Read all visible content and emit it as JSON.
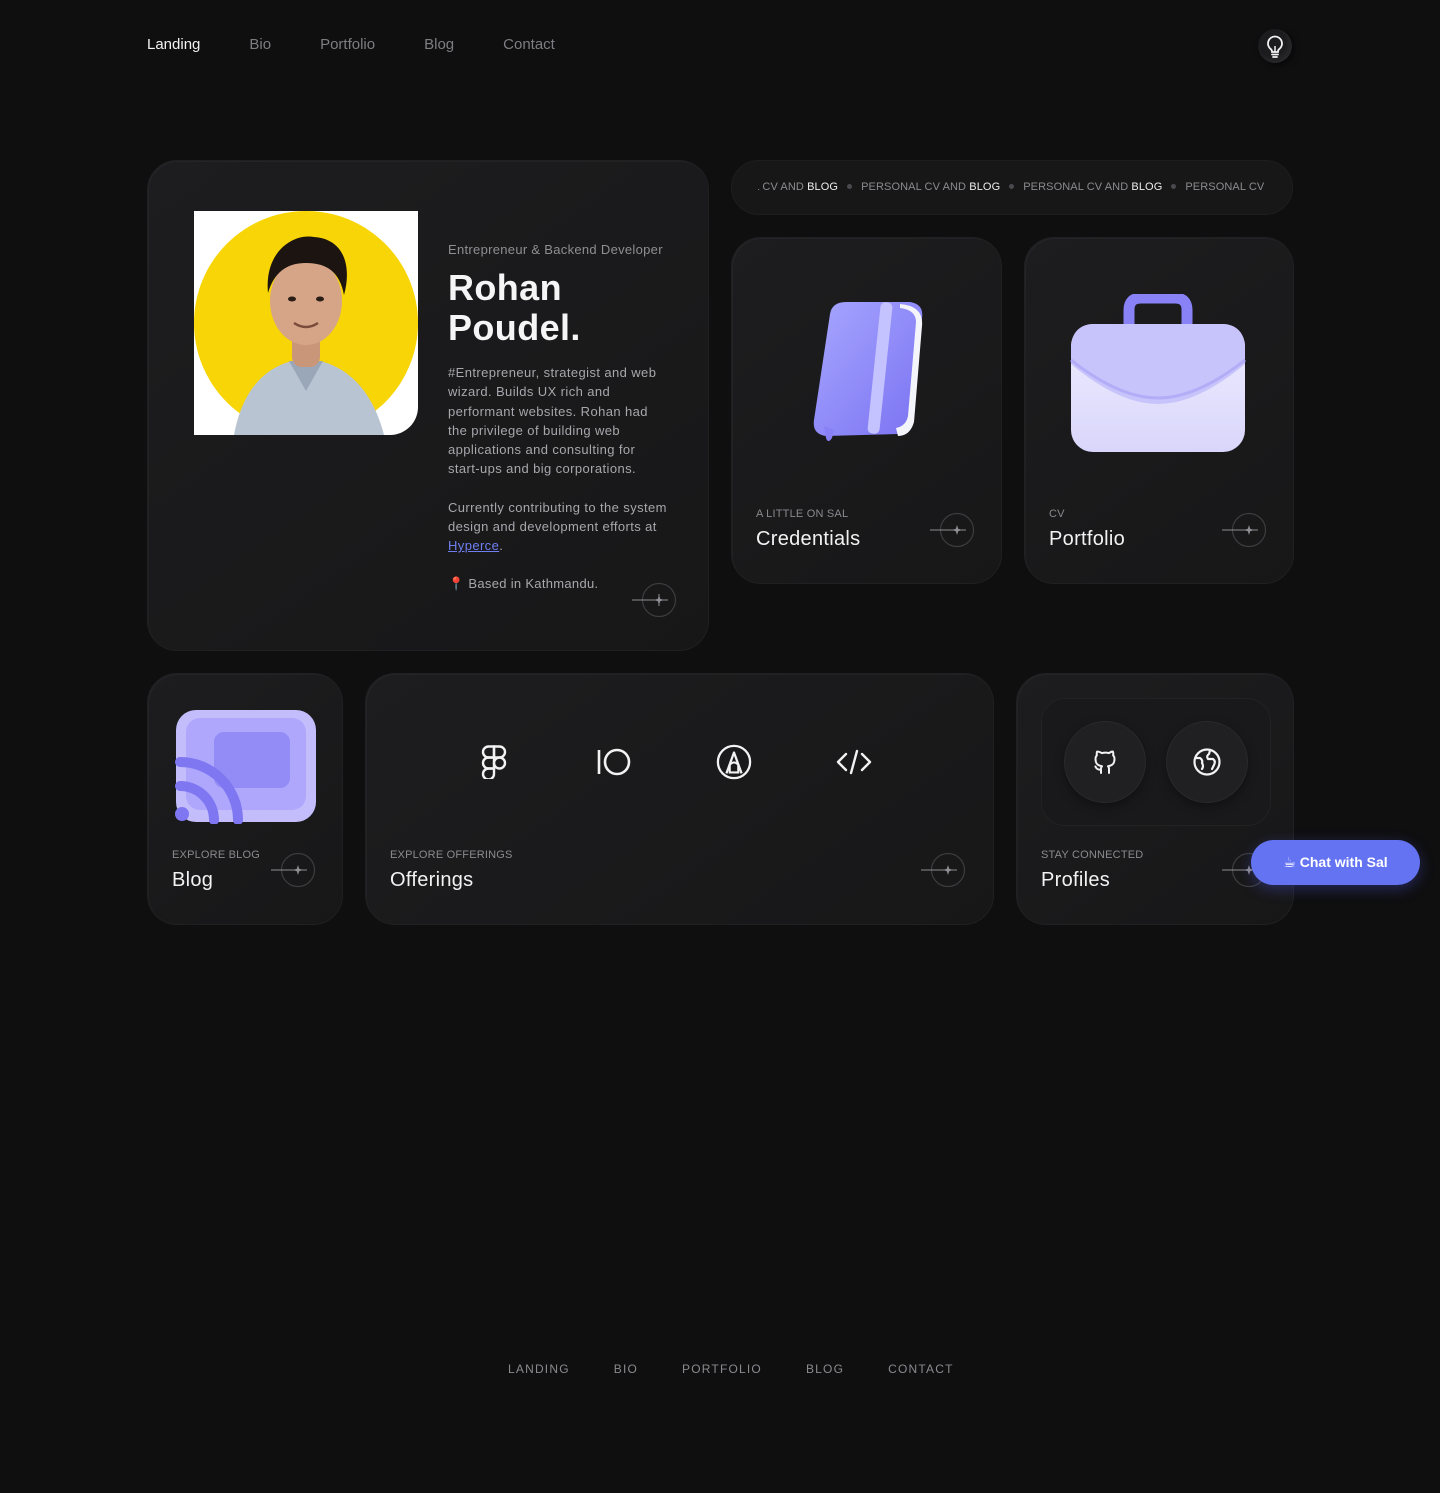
{
  "nav": {
    "items": [
      "Landing",
      "Bio",
      "Portfolio",
      "Blog",
      "Contact"
    ],
    "active": "Landing",
    "theme_toggle_icon": "lightbulb-icon"
  },
  "intro": {
    "role": "Entrepreneur & Backend Developer",
    "name_line1": "Rohan",
    "name_line2": "Poudel.",
    "bio_p1": "#Entrepreneur, strategist and web wizard. Builds UX rich and performant websites. Rohan had the privilege of building web applications and consulting for start-ups and big corporations.",
    "bio_p2_prefix": "Currently contributing to the system design and development efforts at ",
    "bio_p2_link": "Hyperce",
    "bio_p2_suffix": ".",
    "location_icon": "pin-icon",
    "location": "Based in Kathmandu."
  },
  "marquee": {
    "prefix": "AL CV AND ",
    "strong": "BLOG",
    "repeat_prefix": "PERSONAL CV AND ",
    "tail": "PERSONAL CV"
  },
  "cards": {
    "credentials": {
      "eyebrow": "A LITTLE ON SAL",
      "title": "Credentials",
      "icon": "book-icon"
    },
    "portfolio": {
      "eyebrow": "CV",
      "title": "Portfolio",
      "icon": "briefcase-icon"
    },
    "blog": {
      "eyebrow": "EXPLORE BLOG",
      "title": "Blog",
      "icon": "rss-cast-icon"
    },
    "offerings": {
      "eyebrow": "EXPLORE OFFERINGS",
      "title": "Offerings",
      "icons": [
        "figma-icon",
        "framer-io-icon",
        "pen-tool-icon",
        "code-icon"
      ]
    },
    "profiles": {
      "eyebrow": "STAY CONNECTED",
      "title": "Profiles",
      "icons": [
        "github-icon",
        "globe-icon"
      ]
    }
  },
  "chat": {
    "label": "☕ Chat with Sal"
  },
  "footer": {
    "items": [
      "LANDING",
      "BIO",
      "PORTFOLIO",
      "BLOG",
      "CONTACT"
    ]
  },
  "colors": {
    "background": "#0f0f10",
    "accent": "#6373f2",
    "link": "#6f7ff1",
    "avatar_bg": "#f8d506"
  }
}
